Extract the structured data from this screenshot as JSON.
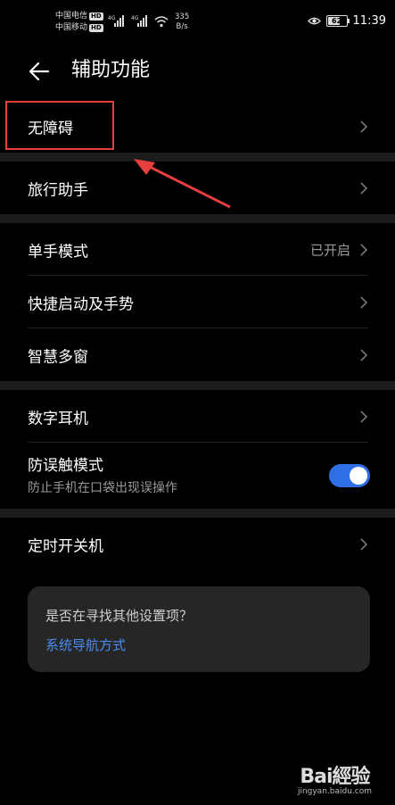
{
  "status_bar": {
    "carrier1": "中国电信",
    "carrier2": "中国移动",
    "hd_label": "HD",
    "network1": "4G",
    "network2": "4G",
    "speed_value": "335",
    "speed_unit": "B/s",
    "battery_level": "62",
    "time": "11:39"
  },
  "header": {
    "title": "辅助功能"
  },
  "sections": {
    "accessibility": {
      "label": "无障碍"
    },
    "travel": {
      "label": "旅行助手"
    },
    "one_hand": {
      "label": "单手模式",
      "value": "已开启"
    },
    "quick_launch": {
      "label": "快捷启动及手势"
    },
    "multi_window": {
      "label": "智慧多窗"
    },
    "digital_earphone": {
      "label": "数字耳机"
    },
    "accidental_touch": {
      "label": "防误触模式",
      "sublabel": "防止手机在口袋出现误操作",
      "enabled": true
    },
    "scheduled_power": {
      "label": "定时开关机"
    }
  },
  "suggestion_card": {
    "question": "是否在寻找其他设置项？",
    "link": "系统导航方式"
  },
  "watermark": {
    "logo": "Bai經验",
    "url": "jingyan.baidu.com"
  },
  "colors": {
    "background": "#000000",
    "section_gap": "#1b1b1b",
    "highlight": "#e5403f",
    "toggle_on": "#2f6fe4",
    "link": "#4b8df2"
  }
}
